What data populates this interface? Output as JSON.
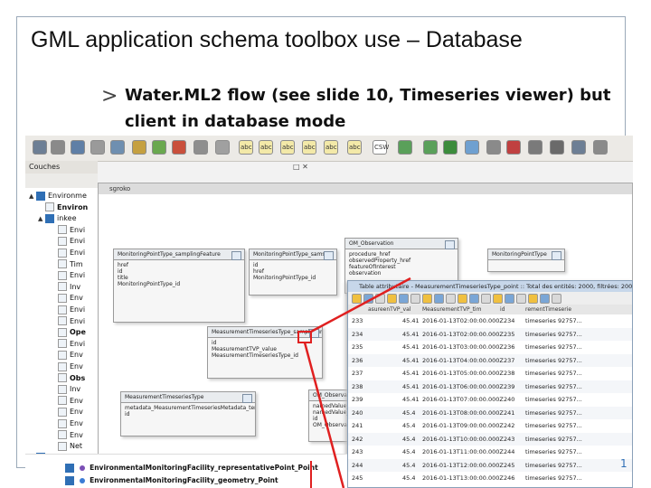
{
  "slide": {
    "title": "GML application schema toolbox use – Database",
    "bullet_marker": ">",
    "bullet_line1": "Water.ML2 flow (see slide 10, Timeseries viewer) but",
    "bullet_line2": "client in database mode"
  },
  "qgis": {
    "toolbar_labels": [
      "abc",
      "abc",
      "abc",
      "abc",
      "abc",
      "abc",
      "CSW"
    ],
    "layers_panel_title": "Couches",
    "layers": [
      {
        "exp": "▲",
        "checked": true,
        "label": "Environme"
      },
      {
        "exp": "",
        "checked": false,
        "label": "Environ"
      },
      {
        "exp": "▲",
        "checked": true,
        "label": "inkee"
      },
      {
        "exp": "",
        "checked": false,
        "label": "Envi"
      },
      {
        "exp": "",
        "checked": false,
        "label": "Envi"
      },
      {
        "exp": "",
        "checked": false,
        "label": "Envi"
      },
      {
        "exp": "",
        "checked": false,
        "label": "Tim"
      },
      {
        "exp": "",
        "checked": false,
        "label": "Envi"
      },
      {
        "exp": "",
        "checked": false,
        "label": "Inv"
      },
      {
        "exp": "",
        "checked": false,
        "label": "Env"
      },
      {
        "exp": "",
        "checked": false,
        "label": "Envi"
      },
      {
        "exp": "",
        "checked": false,
        "label": "Envi"
      },
      {
        "exp": "",
        "checked": false,
        "label": "Ope"
      },
      {
        "exp": "",
        "checked": false,
        "label": "Envi"
      },
      {
        "exp": "",
        "checked": false,
        "label": "Env"
      },
      {
        "exp": "",
        "checked": false,
        "label": "Env"
      },
      {
        "exp": "",
        "checked": false,
        "label": "Obs"
      },
      {
        "exp": "",
        "checked": false,
        "label": "Inv"
      },
      {
        "exp": "",
        "checked": false,
        "label": "Env"
      },
      {
        "exp": "",
        "checked": false,
        "label": "Env"
      },
      {
        "exp": "",
        "checked": false,
        "label": "Env"
      },
      {
        "exp": "",
        "checked": false,
        "label": "Env"
      },
      {
        "exp": "",
        "checked": false,
        "label": "Net"
      },
      {
        "exp": "▲",
        "checked": true,
        "label": "geom"
      }
    ],
    "bottom_layers": [
      "EnvironmentalMonitoringFacility_representativePoint_Point",
      "EnvironmentalMonitoringFacility_geometry_Point"
    ],
    "uml_window_title": "sgroko",
    "uml_boxes": [
      {
        "header": "MonitoringPointType_samplingFeature",
        "body": "href\nid\ntitle\nMonitoringPointType_id"
      },
      {
        "header": "MonitoringPointType_sams",
        "body": "id\nhref\nMonitoringPointType_id"
      },
      {
        "header": "OM_Observation",
        "body": "procedure_href\nobservedProperty_href\nfeatureOfInterest\nobservation"
      },
      {
        "header": "MonitoringPointType",
        "body": ""
      },
      {
        "header": "MeasurementTimeseriesType_sampleRun",
        "body": "id\nMeasurementTVP_value\nMeasurementTimeseriesType_id"
      },
      {
        "header": "Timese",
        "body": "id\ntimePosit"
      },
      {
        "header": "MeasurementTimeseriesType",
        "body": "metadata_MeasurementTimeseriesMetadata_temporalExtent_href\nid"
      },
      {
        "header": "OM_Observa",
        "body": "namedValue_n\nnamedValue_v\nid\nOM_Observa"
      }
    ],
    "attribute_table": {
      "title": "Table attributaire - MeasurementTimeseriesType_point :: Total des entités: 2000, filtrées: 2000, sélectionnées",
      "columns": [
        "asureenTVP_val",
        "MeasurementTVP_tim",
        "id",
        "rementTimeserie"
      ],
      "rows": [
        {
          "n": "233",
          "v": "45.41",
          "t": "2016-01-13T02:00:00.000Z",
          "id": "234",
          "s": "timeseries 92757..."
        },
        {
          "n": "234",
          "v": "45.41",
          "t": "2016-01-13T02:00:00.000Z",
          "id": "235",
          "s": "timeseries 92757..."
        },
        {
          "n": "235",
          "v": "45.41",
          "t": "2016-01-13T03:00:00.000Z",
          "id": "236",
          "s": "timeseries 92757..."
        },
        {
          "n": "236",
          "v": "45.41",
          "t": "2016-01-13T04:00:00.000Z",
          "id": "237",
          "s": "timeseries 92757..."
        },
        {
          "n": "237",
          "v": "45.41",
          "t": "2016-01-13T05:00:00.000Z",
          "id": "238",
          "s": "timeseries 92757..."
        },
        {
          "n": "238",
          "v": "45.41",
          "t": "2016-01-13T06:00:00.000Z",
          "id": "239",
          "s": "timeseries 92757..."
        },
        {
          "n": "239",
          "v": "45.41",
          "t": "2016-01-13T07:00:00.000Z",
          "id": "240",
          "s": "timeseries 92757..."
        },
        {
          "n": "240",
          "v": "45.4",
          "t": "2016-01-13T08:00:00.000Z",
          "id": "241",
          "s": "timeseries 92757..."
        },
        {
          "n": "241",
          "v": "45.4",
          "t": "2016-01-13T09:00:00.000Z",
          "id": "242",
          "s": "timeseries 92757..."
        },
        {
          "n": "242",
          "v": "45.4",
          "t": "2016-01-13T10:00:00.000Z",
          "id": "243",
          "s": "timeseries 92757..."
        },
        {
          "n": "243",
          "v": "45.4",
          "t": "2016-01-13T11:00:00.000Z",
          "id": "244",
          "s": "timeseries 92757..."
        },
        {
          "n": "244",
          "v": "45.4",
          "t": "2016-01-13T12:00:00.000Z",
          "id": "245",
          "s": "timeseries 92757..."
        },
        {
          "n": "245",
          "v": "45.4",
          "t": "2016-01-13T13:00:00.000Z",
          "id": "246",
          "s": "timeseries 92757..."
        }
      ]
    }
  },
  "colors": {
    "frame": "#9aa9b8",
    "highlight_red": "#e02020",
    "table_title": "#c7d7ea"
  }
}
